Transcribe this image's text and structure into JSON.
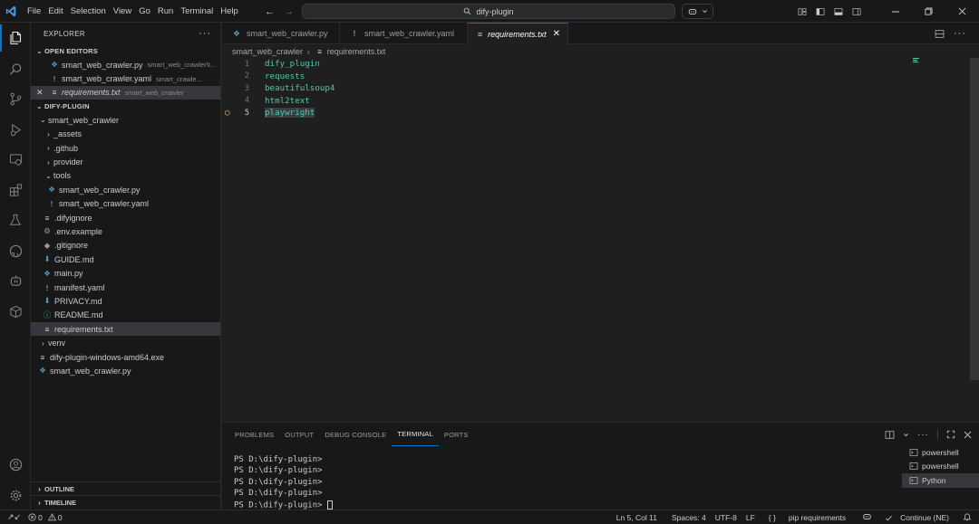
{
  "titlebar": {
    "menu": [
      "File",
      "Edit",
      "Selection",
      "View",
      "Go",
      "Run",
      "Terminal",
      "Help"
    ],
    "search_text": "dify-plugin"
  },
  "sidebar": {
    "title": "EXPLORER",
    "open_editors_label": "OPEN EDITORS",
    "open_editors": [
      {
        "name": "smart_web_crawler.py",
        "desc": "smart_web_crawler\\t...",
        "icon": "python-file-icon"
      },
      {
        "name": "smart_web_crawler.yaml",
        "desc": "smart_crawle...",
        "icon": "yaml-file-icon"
      },
      {
        "name": "requirements.txt",
        "desc": "smart_web_crawler",
        "icon": "text-file-icon"
      }
    ],
    "workspace_label": "DIFY-PLUGIN",
    "tree": [
      {
        "name": "smart_web_crawler",
        "type": "folder-open"
      },
      {
        "name": "_assets",
        "type": "folder"
      },
      {
        "name": ".github",
        "type": "folder"
      },
      {
        "name": "provider",
        "type": "folder"
      },
      {
        "name": "tools",
        "type": "folder-open"
      },
      {
        "name": "smart_web_crawler.py",
        "type": "py"
      },
      {
        "name": "smart_web_crawler.yaml",
        "type": "yaml"
      },
      {
        "name": ".difyignore",
        "type": "txt"
      },
      {
        "name": ".env.example",
        "type": "env"
      },
      {
        "name": ".gitignore",
        "type": "git"
      },
      {
        "name": "GUIDE.md",
        "type": "md"
      },
      {
        "name": "main.py",
        "type": "py"
      },
      {
        "name": "manifest.yaml",
        "type": "yaml"
      },
      {
        "name": "PRIVACY.md",
        "type": "md"
      },
      {
        "name": "README.md",
        "type": "info"
      },
      {
        "name": "requirements.txt",
        "type": "txt"
      },
      {
        "name": "venv",
        "type": "folder"
      },
      {
        "name": "dify-plugin-windows-amd64.exe",
        "type": "txt"
      },
      {
        "name": "smart_web_crawler.py",
        "type": "py"
      }
    ],
    "outline_label": "OUTLINE",
    "timeline_label": "TIMELINE"
  },
  "editor": {
    "tabs": [
      {
        "label": "smart_web_crawler.py",
        "icon": "python-file-icon"
      },
      {
        "label": "smart_web_crawler.yaml",
        "icon": "yaml-file-icon"
      },
      {
        "label": "requirements.txt",
        "icon": "text-file-icon"
      }
    ],
    "breadcrumb": {
      "folder": "smart_web_crawler",
      "file": "requirements.txt"
    },
    "lines": [
      {
        "num": "1",
        "text": "dify_plugin"
      },
      {
        "num": "2",
        "text": "requests"
      },
      {
        "num": "3",
        "text": "beautifulsoup4"
      },
      {
        "num": "4",
        "text": "html2text"
      },
      {
        "num": "5",
        "text": "playwright"
      }
    ]
  },
  "panel": {
    "tabs": [
      "PROBLEMS",
      "OUTPUT",
      "DEBUG CONSOLE",
      "TERMINAL",
      "PORTS"
    ],
    "terminal_lines": [
      "PS D:\\dify-plugin>",
      "PS D:\\dify-plugin>",
      "PS D:\\dify-plugin>",
      "PS D:\\dify-plugin>",
      "PS D:\\dify-plugin>"
    ],
    "terminals": [
      "powershell",
      "powershell",
      "Python"
    ]
  },
  "statusbar": {
    "errors": "0",
    "warnings": "0",
    "position": "Ln 5, Col 11",
    "spaces": "Spaces: 4",
    "encoding": "UTF-8",
    "eol": "LF",
    "language": "pip requirements",
    "continue": "Continue (NE)"
  },
  "colors": {
    "accent": "#0078d4",
    "code_text": "#4ec9b0",
    "background": "#1f1f1f"
  }
}
